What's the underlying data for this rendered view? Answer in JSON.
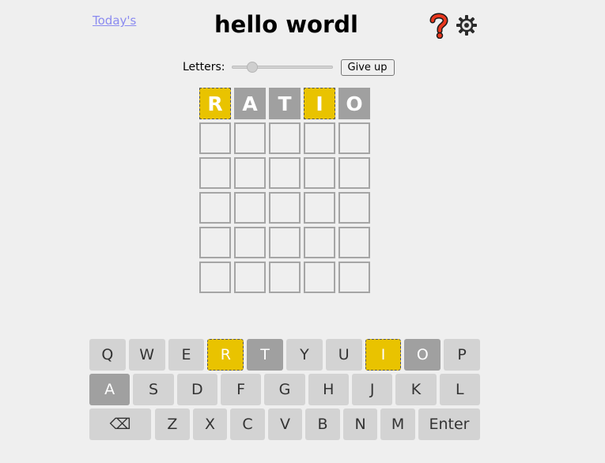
{
  "header": {
    "today_link": "Today's",
    "title": "hello wordl",
    "help_icon": "question-mark-icon",
    "settings_icon": "gear-icon"
  },
  "controls": {
    "letters_label": "Letters:",
    "letters_slider_fraction": 0.17,
    "give_up_label": "Give up"
  },
  "colors": {
    "present": "#e9c300",
    "absent": "#a0a0a0",
    "key_default": "#d3d3d3",
    "background": "#efefef"
  },
  "board": {
    "rows": [
      [
        {
          "letter": "R",
          "state": "present"
        },
        {
          "letter": "A",
          "state": "absent"
        },
        {
          "letter": "T",
          "state": "absent"
        },
        {
          "letter": "I",
          "state": "present"
        },
        {
          "letter": "O",
          "state": "absent"
        }
      ],
      [
        {
          "letter": "",
          "state": "empty"
        },
        {
          "letter": "",
          "state": "empty"
        },
        {
          "letter": "",
          "state": "empty"
        },
        {
          "letter": "",
          "state": "empty"
        },
        {
          "letter": "",
          "state": "empty"
        }
      ],
      [
        {
          "letter": "",
          "state": "empty"
        },
        {
          "letter": "",
          "state": "empty"
        },
        {
          "letter": "",
          "state": "empty"
        },
        {
          "letter": "",
          "state": "empty"
        },
        {
          "letter": "",
          "state": "empty"
        }
      ],
      [
        {
          "letter": "",
          "state": "empty"
        },
        {
          "letter": "",
          "state": "empty"
        },
        {
          "letter": "",
          "state": "empty"
        },
        {
          "letter": "",
          "state": "empty"
        },
        {
          "letter": "",
          "state": "empty"
        }
      ],
      [
        {
          "letter": "",
          "state": "empty"
        },
        {
          "letter": "",
          "state": "empty"
        },
        {
          "letter": "",
          "state": "empty"
        },
        {
          "letter": "",
          "state": "empty"
        },
        {
          "letter": "",
          "state": "empty"
        }
      ],
      [
        {
          "letter": "",
          "state": "empty"
        },
        {
          "letter": "",
          "state": "empty"
        },
        {
          "letter": "",
          "state": "empty"
        },
        {
          "letter": "",
          "state": "empty"
        },
        {
          "letter": "",
          "state": "empty"
        }
      ]
    ]
  },
  "keyboard": {
    "rows": [
      [
        {
          "label": "Q",
          "state": ""
        },
        {
          "label": "W",
          "state": ""
        },
        {
          "label": "E",
          "state": ""
        },
        {
          "label": "R",
          "state": "present"
        },
        {
          "label": "T",
          "state": "absent"
        },
        {
          "label": "Y",
          "state": ""
        },
        {
          "label": "U",
          "state": ""
        },
        {
          "label": "I",
          "state": "present"
        },
        {
          "label": "O",
          "state": "absent"
        },
        {
          "label": "P",
          "state": ""
        }
      ],
      [
        {
          "label": "A",
          "state": "absent"
        },
        {
          "label": "S",
          "state": ""
        },
        {
          "label": "D",
          "state": ""
        },
        {
          "label": "F",
          "state": ""
        },
        {
          "label": "G",
          "state": ""
        },
        {
          "label": "H",
          "state": ""
        },
        {
          "label": "J",
          "state": ""
        },
        {
          "label": "K",
          "state": ""
        },
        {
          "label": "L",
          "state": ""
        }
      ],
      [
        {
          "label": "⌫",
          "state": "",
          "name": "backspace-key"
        },
        {
          "label": "Z",
          "state": ""
        },
        {
          "label": "X",
          "state": ""
        },
        {
          "label": "C",
          "state": ""
        },
        {
          "label": "V",
          "state": ""
        },
        {
          "label": "B",
          "state": ""
        },
        {
          "label": "N",
          "state": ""
        },
        {
          "label": "M",
          "state": ""
        },
        {
          "label": "Enter",
          "state": "",
          "name": "enter-key"
        }
      ]
    ]
  }
}
